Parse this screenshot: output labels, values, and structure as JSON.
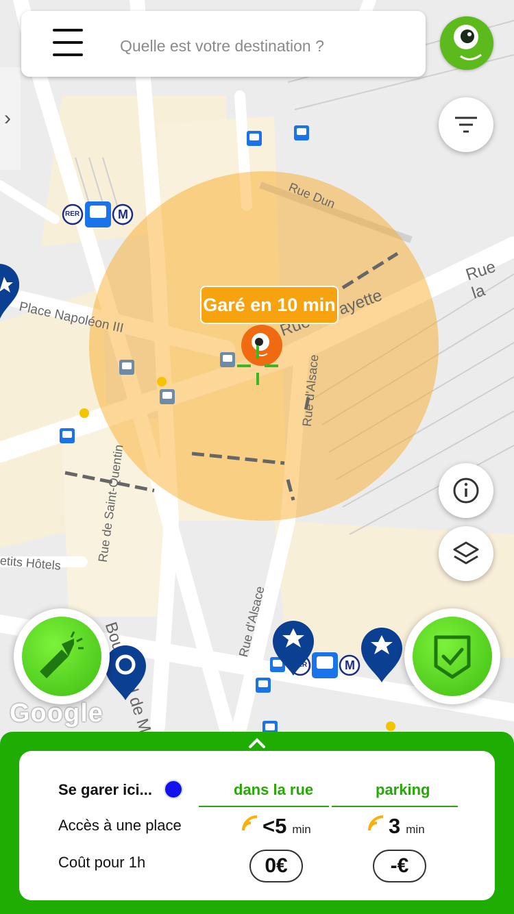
{
  "search": {
    "placeholder": "Quelle est votre destination ?"
  },
  "map": {
    "parked_label": "Garé en 10 min",
    "street_labels": {
      "rue_la_fayette": "Rue la Fayette",
      "rue_la": "Rue la",
      "place_napoleon": "Place Napoléon III",
      "rue_alsace": "Rue d'Alsace",
      "rue_alsace_2": "Rue d'Alsace",
      "rue_st_quentin": "Rue de Saint-Quentin",
      "bd_magenta": "Boulevard de Ma",
      "petits_hotels": "etits Hôtels",
      "rue_dun": "Rue Dun"
    },
    "transit_labels": {
      "rer": "RER",
      "metro": "M"
    },
    "google": "Google"
  },
  "panel": {
    "title": "Se garer ici...",
    "columns": [
      "dans la rue",
      "parking"
    ],
    "rows": {
      "access_label": "Accès à une place",
      "cost_label": "Coût pour 1h"
    },
    "access": [
      {
        "value": "<5",
        "unit": "min"
      },
      {
        "value": "3",
        "unit": "min"
      }
    ],
    "cost": [
      "0€",
      "-€"
    ]
  },
  "colors": {
    "accent_green": "#1fac03",
    "orange": "#f7a20f",
    "marker_blue": "#0b3f91"
  }
}
